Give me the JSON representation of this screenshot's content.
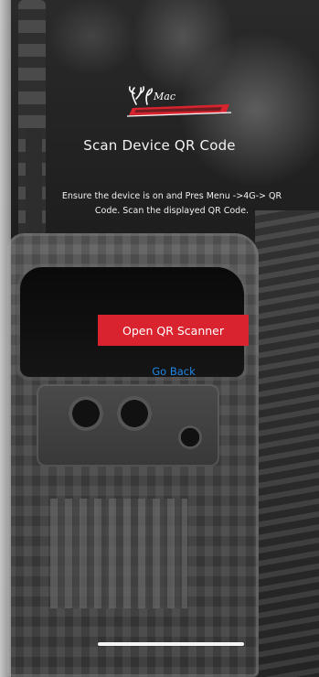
{
  "screen": {
    "title": "Scan Device QR Code",
    "instructions": "Ensure the device is on and Pres Menu ->4G-> QR Code. Scan the displayed QR Code.",
    "open_button_label": "Open QR Scanner",
    "back_label": "Go Back"
  },
  "logo": {
    "icon": "brand-logo",
    "accent_color": "#d9232e"
  },
  "colors": {
    "primary_button": "#d9232e",
    "link": "#1e88e5",
    "text": "#ffffff"
  }
}
